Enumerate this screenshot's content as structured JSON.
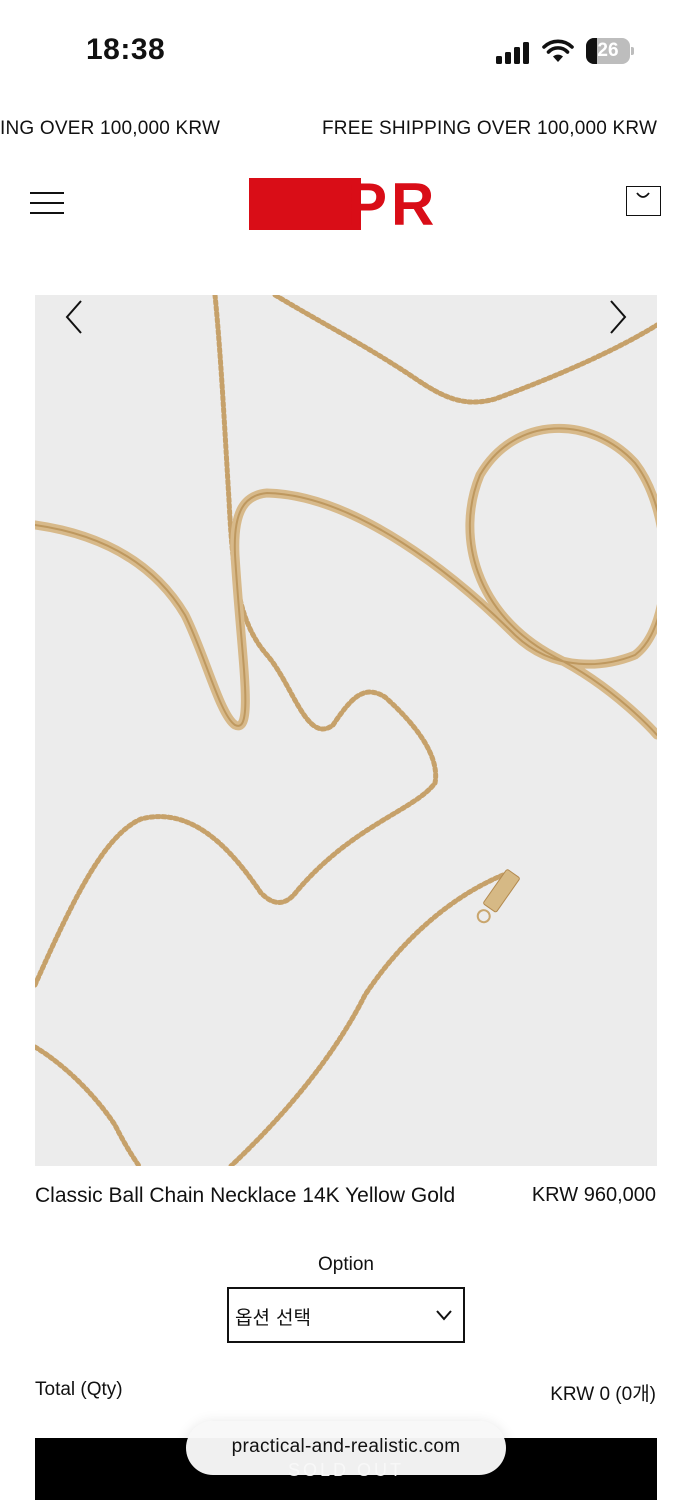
{
  "status_bar": {
    "time": "18:38",
    "battery_level": "26",
    "icons": [
      "cellular-signal-icon",
      "wifi-icon",
      "battery-icon"
    ]
  },
  "announcement": {
    "text_partial": "ING OVER 100,000 KRW",
    "text": "FREE SHIPPING OVER 100,000 KRW"
  },
  "header": {
    "logo_text": "PR",
    "brand_color": "#d90d17",
    "icons": [
      "hamburger-menu-icon",
      "shopping-bag-icon"
    ]
  },
  "gallery": {
    "background_color": "#ececec",
    "icons": [
      "chevron-left-icon",
      "chevron-right-icon"
    ]
  },
  "product": {
    "name": "Classic Ball Chain Necklace 14K Yellow Gold",
    "price": "KRW 960,000"
  },
  "option": {
    "label": "Option",
    "selected": "옵션 선택"
  },
  "total": {
    "label": "Total (Qty)",
    "value": "KRW 0 (0개)"
  },
  "cta": {
    "label": "SOLD OUT"
  },
  "browser": {
    "url": "practical-and-realistic.com"
  }
}
